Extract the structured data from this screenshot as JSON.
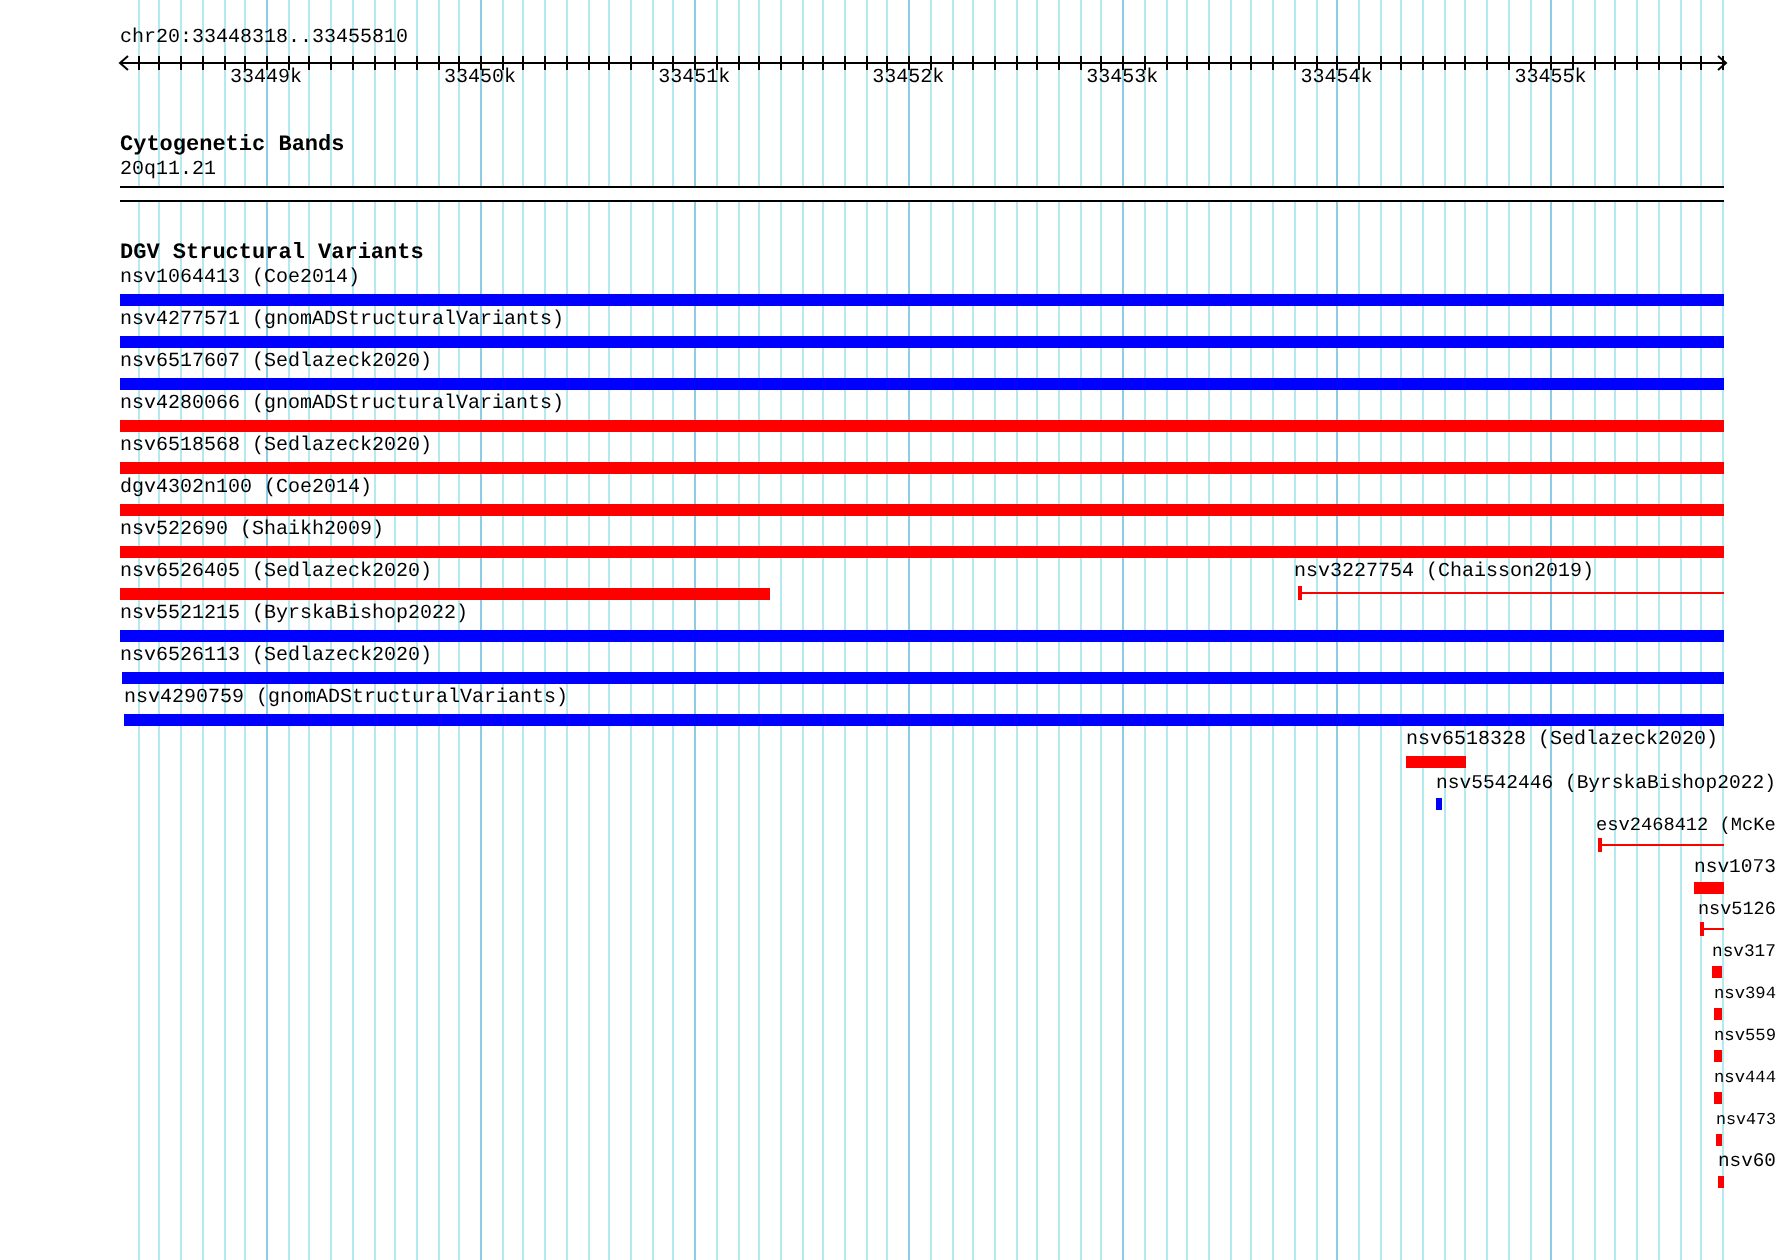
{
  "ruler": {
    "location": "chr20:33448318..33455810",
    "tick_labels": [
      "33449k",
      "33450k",
      "33451k",
      "33452k",
      "33453k",
      "33454k",
      "33455k"
    ]
  },
  "cytoband_track": {
    "title": "Cytogenetic Bands",
    "band": "20q11.21"
  },
  "variant_track": {
    "title": "DGV Structural Variants",
    "features": [
      {
        "label": "nsv1064413 (Coe2014)",
        "color": "#0000ff",
        "kind": "bar"
      },
      {
        "label": "nsv4277571 (gnomADStructuralVariants)",
        "color": "#0000ff",
        "kind": "bar"
      },
      {
        "label": "nsv6517607 (Sedlazeck2020)",
        "color": "#0000ff",
        "kind": "bar"
      },
      {
        "label": "nsv4280066 (gnomADStructuralVariants)",
        "color": "#ff0000",
        "kind": "bar"
      },
      {
        "label": "nsv6518568 (Sedlazeck2020)",
        "color": "#ff0000",
        "kind": "bar"
      },
      {
        "label": "dgv4302n100 (Coe2014)",
        "color": "#ff0000",
        "kind": "bar"
      },
      {
        "label": "nsv522690 (Shaikh2009)",
        "color": "#ff0000",
        "kind": "bar"
      },
      {
        "label": "nsv6526405 (Sedlazeck2020)",
        "color": "#ff0000",
        "kind": "bar"
      },
      {
        "label": "nsv3227754 (Chaisson2019)",
        "color": "#ff0000",
        "kind": "line"
      },
      {
        "label": "nsv5521215 (ByrskaBishop2022)",
        "color": "#0000ff",
        "kind": "bar"
      },
      {
        "label": "nsv6526113 (Sedlazeck2020)",
        "color": "#0000ff",
        "kind": "bar"
      },
      {
        "label": "nsv4290759 (gnomADStructuralVariants)",
        "color": "#0000ff",
        "kind": "bar"
      },
      {
        "label": "nsv6518328 (Sedlazeck2020)",
        "color": "#ff0000",
        "kind": "bar"
      },
      {
        "label": "nsv5542446 (ByrskaBishop2022)",
        "color": "#0000ff",
        "kind": "bar"
      },
      {
        "label": "esv2468412 (McKe",
        "color": "#ff0000",
        "kind": "line"
      },
      {
        "label": "nsv1073",
        "color": "#ff0000",
        "kind": "bar"
      },
      {
        "label": "nsv5126",
        "color": "#ff0000",
        "kind": "line"
      },
      {
        "label": "nsv317",
        "color": "#ff0000",
        "kind": "bar"
      },
      {
        "label": "nsv394",
        "color": "#ff0000",
        "kind": "bar"
      },
      {
        "label": "nsv559",
        "color": "#ff0000",
        "kind": "bar"
      },
      {
        "label": "nsv444",
        "color": "#ff0000",
        "kind": "bar"
      },
      {
        "label": "nsv473",
        "color": "#ff0000",
        "kind": "bar"
      },
      {
        "label": "nsv60",
        "color": "#ff0000",
        "kind": "bar"
      }
    ]
  }
}
